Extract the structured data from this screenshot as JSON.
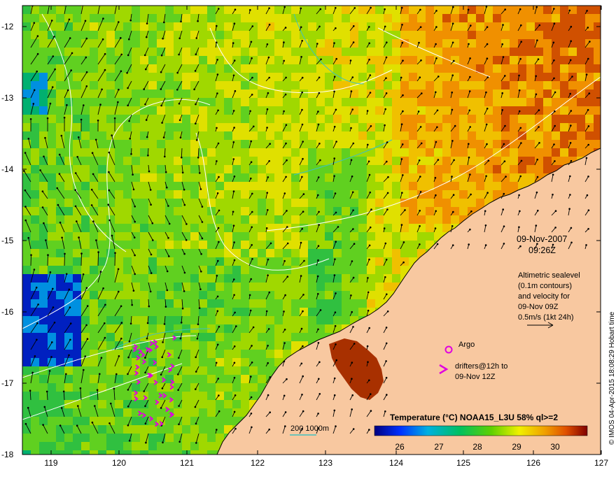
{
  "map": {
    "date_line": "09-Nov-2007",
    "time_line": "09:26Z",
    "altimetry_lines": [
      "Altimetric sealevel",
      "(0.1m contours)",
      "and velocity for",
      "09-Nov 09Z",
      "0.5m/s (1kt 24h)"
    ],
    "argo_label": "Argo",
    "drifter_line1": "drifters@12h to",
    "drifter_line2": "09-Nov 12Z",
    "bathymetry_label": "200  1000m",
    "legend_title": "Temperature (°C) NOAA15_L3U 58% ql>=2",
    "legend_ticks": [
      "26",
      "27",
      "28",
      "29",
      "30"
    ],
    "credit": "© IMOS 04-Apr-2015 18:08:29 Hobart time",
    "x_ticks": [
      "119",
      "120",
      "121",
      "122",
      "123",
      "124",
      "125",
      "126",
      "127"
    ],
    "y_ticks": [
      "-12",
      "-13",
      "-14",
      "-15",
      "-16",
      "-17",
      "-18"
    ],
    "colors": {
      "land": "#f8c8a0",
      "arrow": "#000000",
      "contour": "#ffffff",
      "argo": "#e000e0",
      "bathymetry": "#40c0c0"
    }
  }
}
